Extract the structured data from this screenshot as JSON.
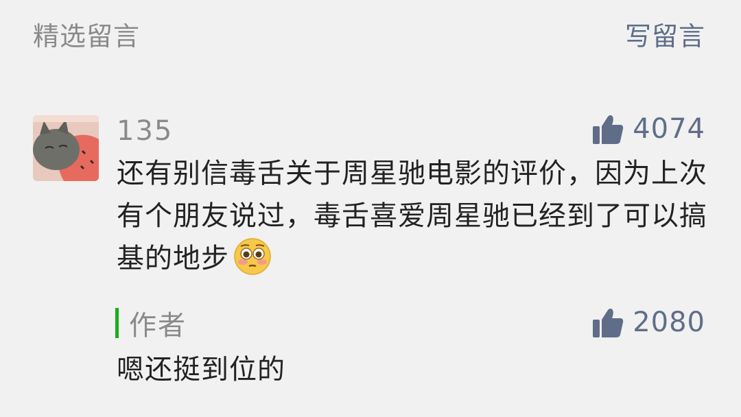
{
  "header": {
    "title": "精选留言",
    "write_label": "写留言"
  },
  "comment": {
    "nickname": "135",
    "avatar_icon": "cat-avatar",
    "likes": "4074",
    "text": "还有别信毒舌关于周星驰电影的评价，因为上次有个朋友说过，毒舌喜爱周星驰已经到了可以搞基的地步",
    "emoji_icon": "flushed-face-emoji"
  },
  "reply": {
    "label": "作者",
    "likes": "2080",
    "text": "嗯还挺到位的"
  },
  "colors": {
    "background": "#f1f1f1",
    "link": "#5f6d88",
    "muted": "#8a8a8a",
    "text": "#222222",
    "author_accent": "#1aad19"
  }
}
